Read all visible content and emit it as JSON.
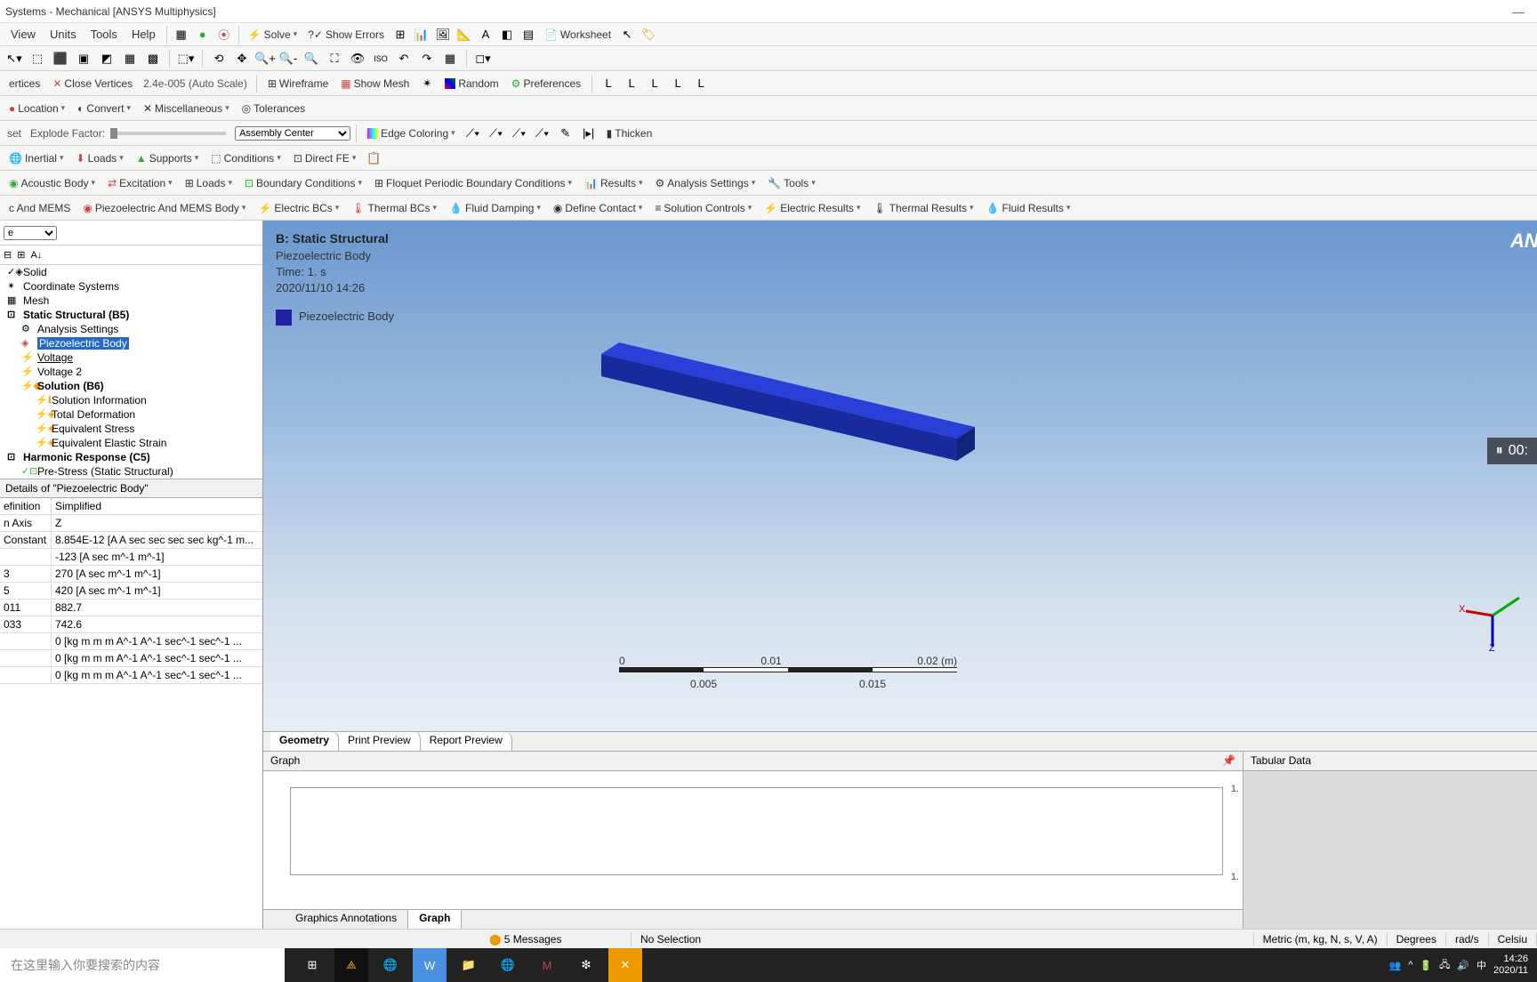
{
  "window": {
    "title": "Systems - Mechanical [ANSYS Multiphysics]"
  },
  "menu": {
    "view": "View",
    "units": "Units",
    "tools": "Tools",
    "help": "Help",
    "solve": "Solve",
    "show_errors": "Show Errors",
    "worksheet": "Worksheet"
  },
  "tb1": {
    "auto_scale": "2.4e-005 (Auto Scale)",
    "vertices": "ertices",
    "close_vertices": "Close Vertices",
    "wireframe": "Wireframe",
    "show_mesh": "Show Mesh",
    "random": "Random",
    "preferences": "Preferences"
  },
  "tb2": {
    "location": "Location",
    "convert": "Convert",
    "misc": "Miscellaneous",
    "tolerances": "Tolerances"
  },
  "tb3": {
    "set": "set",
    "explode": "Explode Factor:",
    "assembly": "Assembly Center",
    "edge_color": "Edge Coloring",
    "thicken": "Thicken"
  },
  "tb4": {
    "inertial": "Inertial",
    "loads": "Loads",
    "supports": "Supports",
    "conditions": "Conditions",
    "direct_fe": "Direct FE"
  },
  "tb5": {
    "acoustic": "Acoustic Body",
    "excitation": "Excitation",
    "loads": "Loads",
    "bc": "Boundary Conditions",
    "fpbc": "Floquet Periodic Boundary Conditions",
    "results": "Results",
    "analysis": "Analysis Settings",
    "tools": "Tools"
  },
  "tb6": {
    "mems": "c And MEMS",
    "piezo_body": "Piezoelectric And MEMS Body",
    "electric": "Electric BCs",
    "thermal": "Thermal BCs",
    "fluid_damp": "Fluid Damping",
    "contact": "Define Contact",
    "solution": "Solution Controls",
    "eresults": "Electric Results",
    "tresults": "Thermal Results",
    "fresults": "Fluid Results"
  },
  "tree": {
    "solid": "Solid",
    "coords": "Coordinate Systems",
    "mesh": "Mesh",
    "static": "Static Structural (B5)",
    "analysis": "Analysis Settings",
    "piezo": "Piezoelectric Body",
    "voltage": "Voltage",
    "voltage2": "Voltage 2",
    "solution": "Solution (B6)",
    "solinfo": "Solution Information",
    "totdef": "Total Deformation",
    "eqstress": "Equivalent Stress",
    "eqstrain": "Equivalent Elastic Strain",
    "harmonic": "Harmonic Response (C5)",
    "prestress": "Pre-Stress (Static Structural)"
  },
  "details": {
    "header": "iezoelectric Body\"",
    "rows": [
      {
        "l": "efinition",
        "r": "Simplified"
      },
      {
        "l": "n Axis",
        "r": "Z"
      },
      {
        "l": " Constant",
        "r": "8.854E-12 [A A sec sec sec sec kg^-1 m..."
      },
      {
        "l": "",
        "r": "-123 [A sec m^-1 m^-1]"
      },
      {
        "l": "3",
        "r": "270 [A sec m^-1 m^-1]"
      },
      {
        "l": "5",
        "r": "420 [A sec m^-1 m^-1]"
      },
      {
        "l": "011",
        "r": "882.7"
      },
      {
        "l": "033",
        "r": "742.6"
      },
      {
        "l": "",
        "r": "0 [kg m m m A^-1 A^-1 sec^-1 sec^-1 ..."
      },
      {
        "l": "",
        "r": "0 [kg m m m A^-1 A^-1 sec^-1 sec^-1 ..."
      },
      {
        "l": "",
        "r": "0 [kg m m m A^-1 A^-1 sec^-1 sec^-1 ..."
      }
    ]
  },
  "viewport": {
    "title": "B: Static Structural",
    "sub1": "Piezoelectric Body",
    "sub2": "Time: 1. s",
    "sub3": "2020/11/10 14:26",
    "legend": "Piezoelectric Body",
    "scale": {
      "t0": "0",
      "t1": "0.005",
      "t2": "0.01",
      "t3": "0.015",
      "t4": "0.02 (m)"
    },
    "tabs": {
      "geometry": "Geometry",
      "print": "Print Preview",
      "report": "Report Preview"
    },
    "logo": "AN"
  },
  "graph": {
    "header": "Graph",
    "y1": "1.",
    "y2": "1.",
    "tabs": {
      "ann": "Graphics Annotations",
      "graph": "Graph"
    }
  },
  "tabular": {
    "header": "Tabular Data"
  },
  "status": {
    "messages": "5 Messages",
    "selection": "No Selection",
    "units": "Metric (m, kg, N, s, V, A)",
    "degrees": "Degrees",
    "rads": "rad/s",
    "celsius": "Celsiu"
  },
  "video": {
    "time": "00:"
  },
  "taskbar": {
    "search": "在这里输入你要搜索的内容",
    "ime": "中",
    "time": "14:26",
    "date": "2020/11"
  }
}
